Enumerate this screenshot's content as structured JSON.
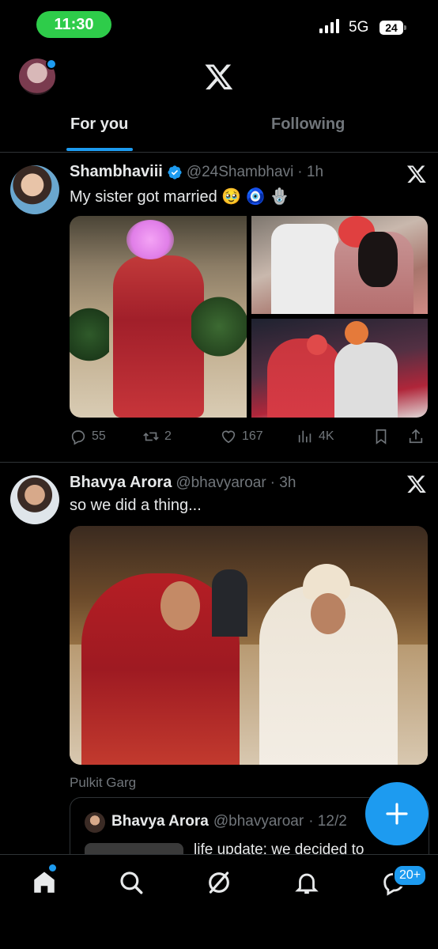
{
  "status_bar": {
    "time": "11:30",
    "network": "5G",
    "battery": "24"
  },
  "header": {
    "logo_icon": "x-logo-icon",
    "profile_icon": "profile-avatar"
  },
  "tabs": [
    {
      "label": "For you",
      "active": true
    },
    {
      "label": "Following",
      "active": false
    }
  ],
  "tweets": [
    {
      "name": "Shambhaviii",
      "verified": true,
      "handle": "@24Shambhavi",
      "time": "· 1h",
      "text": "My sister got married 🥹 🧿 🪬",
      "actions": {
        "replies": "55",
        "retweets": "2",
        "likes": "167",
        "views": "4K"
      }
    },
    {
      "name": "Bhavya Arora",
      "handle": "@bhavyaroar",
      "time": "· 3h",
      "text": "so we did a thing...",
      "photo_credit": "Pulkit Garg",
      "quote": {
        "name": "Bhavya Arora",
        "handle": "@bhavyaroar",
        "time": "· 12/2",
        "text": "life update: we decided to"
      }
    }
  ],
  "fab": {
    "icon": "plus-icon"
  },
  "bottom_nav": {
    "items": [
      "home-icon",
      "search-icon",
      "grok-icon",
      "notifications-icon",
      "messages-icon"
    ],
    "messages_badge": "20+"
  },
  "colors": {
    "accent": "#1d9bf0",
    "status_green": "#2ecc4a",
    "muted": "#71767b",
    "divider": "#2f3336"
  }
}
